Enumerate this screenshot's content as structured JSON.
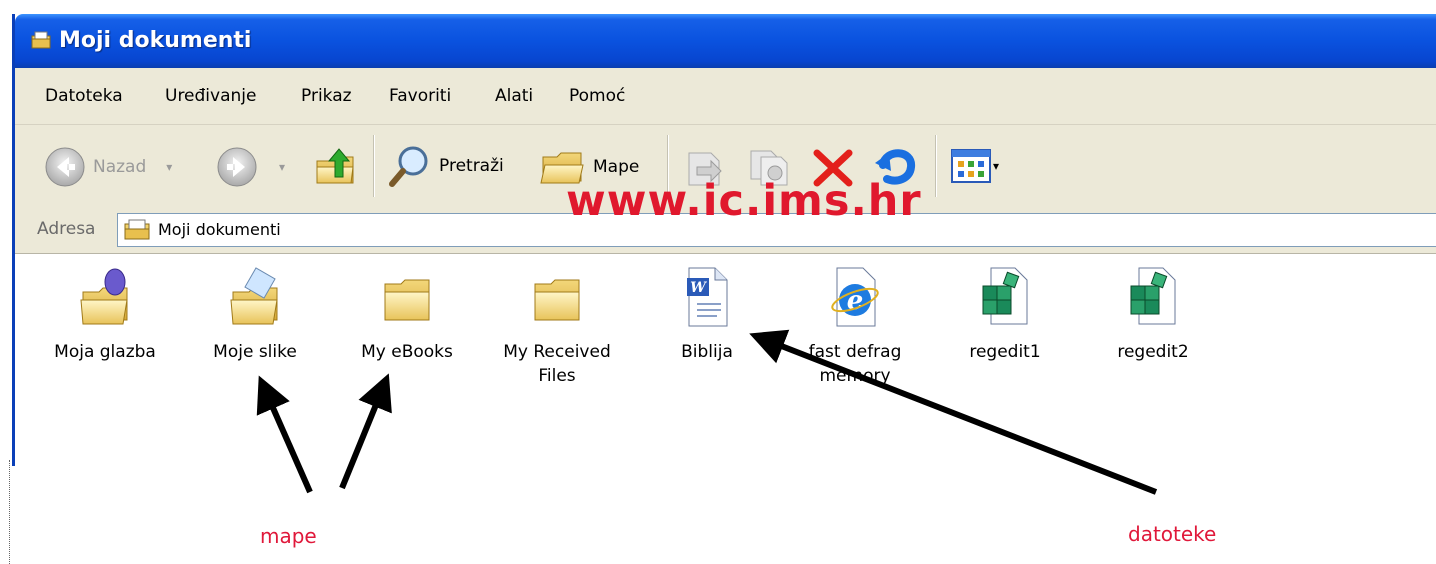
{
  "window": {
    "title": "Moji dokumenti"
  },
  "menu": [
    {
      "label": "Datoteka"
    },
    {
      "label": "Uređivanje"
    },
    {
      "label": "Prikaz"
    },
    {
      "label": "Favoriti"
    },
    {
      "label": "Alati"
    },
    {
      "label": "Pomoć"
    }
  ],
  "toolbar": {
    "back_label": "Nazad",
    "search_label": "Pretraži",
    "folders_label": "Mape"
  },
  "address": {
    "label": "Adresa",
    "value": "Moji dokumenti"
  },
  "watermark": "www.ic.ims.hr",
  "items": [
    {
      "label": "Moja glazba",
      "icon": "music-folder-icon"
    },
    {
      "label": "Moje slike",
      "icon": "pictures-folder-icon"
    },
    {
      "label": "My eBooks",
      "icon": "folder-icon"
    },
    {
      "label": "My Received Files",
      "icon": "folder-icon"
    },
    {
      "label": "Biblija",
      "icon": "word-document-icon"
    },
    {
      "label": "fast defrag memory",
      "icon": "internet-explorer-icon"
    },
    {
      "label": "regedit1",
      "icon": "registry-file-icon"
    },
    {
      "label": "regedit2",
      "icon": "registry-file-icon"
    }
  ],
  "annotations": {
    "folders": "mape",
    "files": "datoteke"
  },
  "colors": {
    "titlebar": "#0a52df",
    "annotation": "#e0183a",
    "watermark": "#e0182d"
  }
}
